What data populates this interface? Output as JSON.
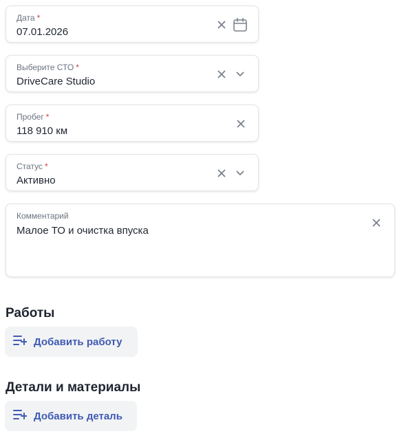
{
  "fields": {
    "date": {
      "label": "Дата",
      "required_mark": "*",
      "value": "07.01.2026"
    },
    "service": {
      "label": "Выберите СТО",
      "required_mark": "*",
      "value": "DriveCare Studio"
    },
    "mileage": {
      "label": "Пробег",
      "required_mark": "*",
      "value": "118 910 км"
    },
    "status": {
      "label": "Статус",
      "required_mark": "*",
      "value": "Активно"
    },
    "comment": {
      "label": "Комментарий",
      "value": "Малое ТО и очистка впуска"
    }
  },
  "works": {
    "title": "Работы",
    "add_label": "Добавить работу"
  },
  "parts": {
    "title": "Детали и материалы",
    "add_label": "Добавить деталь"
  },
  "icons": {
    "clear": "close-icon",
    "calendar": "calendar-icon",
    "dropdown": "chevron-down-icon",
    "add_list": "playlist-add-icon"
  },
  "colors": {
    "accent": "#3f5bb3",
    "required": "#d14343",
    "icon": "#7a808c",
    "button_bg": "#f2f3f5"
  }
}
